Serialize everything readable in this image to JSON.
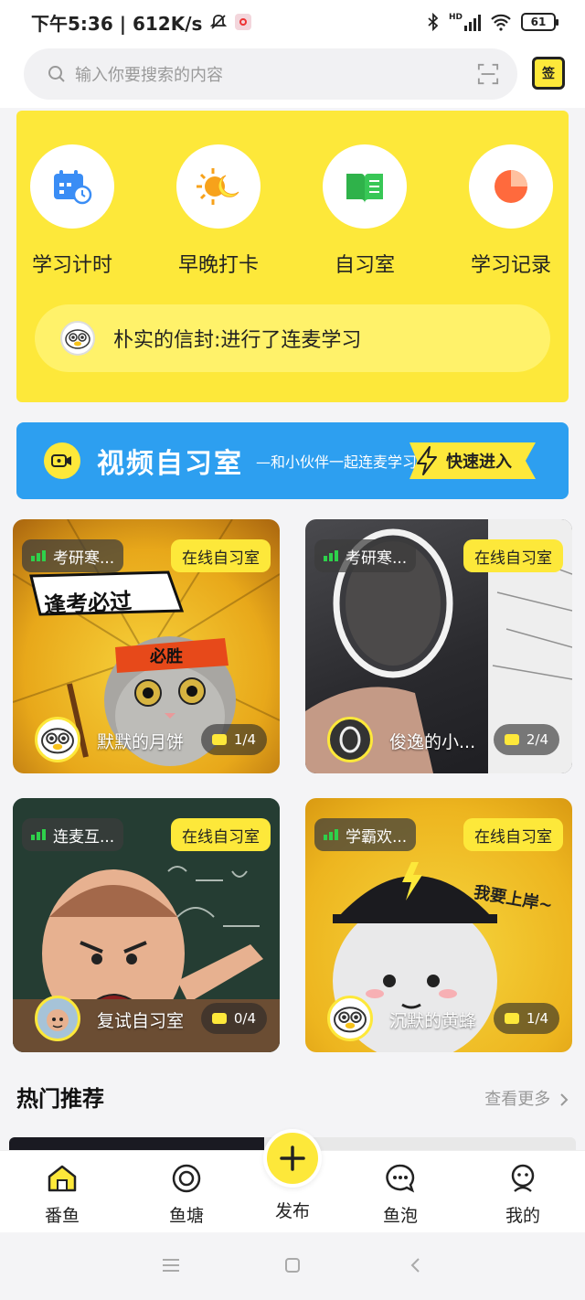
{
  "status_bar": {
    "left_text": "下午5:36 | 612K/s",
    "battery": "61",
    "network": "HD"
  },
  "search": {
    "placeholder": "输入你要搜索的内容",
    "checkin_label": "签"
  },
  "shortcuts": [
    {
      "label": "学习计时",
      "icon": "calendar-clock-icon"
    },
    {
      "label": "早晚打卡",
      "icon": "sun-moon-icon"
    },
    {
      "label": "自习室",
      "icon": "open-book-icon"
    },
    {
      "label": "学习记录",
      "icon": "pie-chart-icon"
    }
  ],
  "ticker": {
    "text": "朴实的信封:进行了连麦学习"
  },
  "video_banner": {
    "title": "视频自习室",
    "subtitle": "—和小伙伴一起连麦学习",
    "enter_label": "快速进入"
  },
  "rooms": [
    {
      "tag": "考研寒...",
      "badge": "在线自习室",
      "host": "默默的月饼",
      "seats": "1/4"
    },
    {
      "tag": "考研寒...",
      "badge": "在线自习室",
      "host": "俊逸的小...",
      "seats": "2/4"
    },
    {
      "tag": "连麦互...",
      "badge": "在线自习室",
      "host": "复试自习室",
      "seats": "0/4"
    },
    {
      "tag": "学霸欢...",
      "badge": "在线自习室",
      "host": "沉默的黄蜂",
      "seats": "1/4"
    }
  ],
  "room_images": {
    "card1_text_a": "逢考必过",
    "card1_text_b": "必胜",
    "card4_text": "我要上岸~"
  },
  "hot": {
    "title": "热门推荐",
    "see_more": "查看更多"
  },
  "bottom_nav": [
    {
      "label": "番鱼",
      "icon": "home-icon"
    },
    {
      "label": "鱼塘",
      "icon": "pond-icon"
    },
    {
      "label": "发布",
      "icon": "plus-icon"
    },
    {
      "label": "鱼泡",
      "icon": "chat-bubble-icon"
    },
    {
      "label": "我的",
      "icon": "profile-icon"
    }
  ],
  "colors": {
    "brand_yellow": "#fde83a",
    "banner_blue": "#2d9ff0",
    "signal_green": "#2ed14b"
  }
}
